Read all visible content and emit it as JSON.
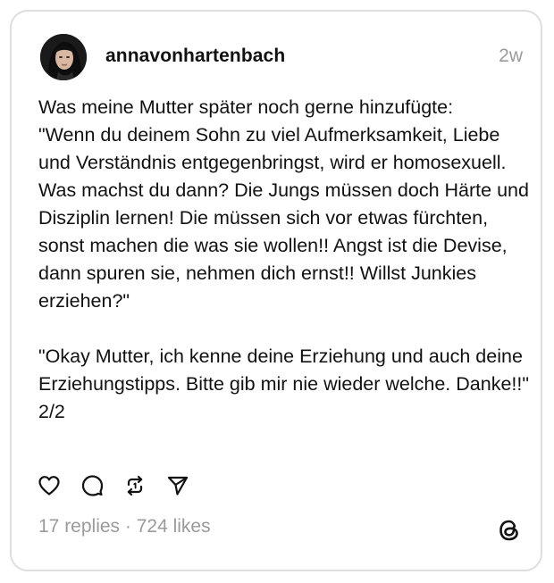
{
  "post": {
    "username": "annavonhartenbach",
    "time_ago": "2w",
    "text": "Was meine Mutter später noch gerne hinzufügte:\n\"Wenn du deinem Sohn zu viel Aufmerksamkeit, Liebe und Verständnis entgegenbringst, wird er homosexuell. Was machst du dann? Die Jungs müssen doch Härte und Disziplin lernen! Die müssen sich vor etwas fürchten, sonst machen die was sie wollen!! Angst ist die Devise, dann spuren sie, nehmen dich ernst!! Willst Junkies erziehen?\"\n\n\"Okay Mutter, ich kenne deine Erziehung und auch deine Erziehungstipps. Bitte gib mir nie wieder welche. Danke!!\"\n2/2",
    "stats": "17 replies · 724 likes"
  },
  "icons": {
    "like": "heart-icon",
    "reply": "comment-bubble-icon",
    "repost": "repost-icon",
    "share": "send-icon",
    "brand": "threads-logo-icon"
  },
  "colors": {
    "text": "#111111",
    "muted": "#9a9a9a",
    "border": "#dedede"
  }
}
